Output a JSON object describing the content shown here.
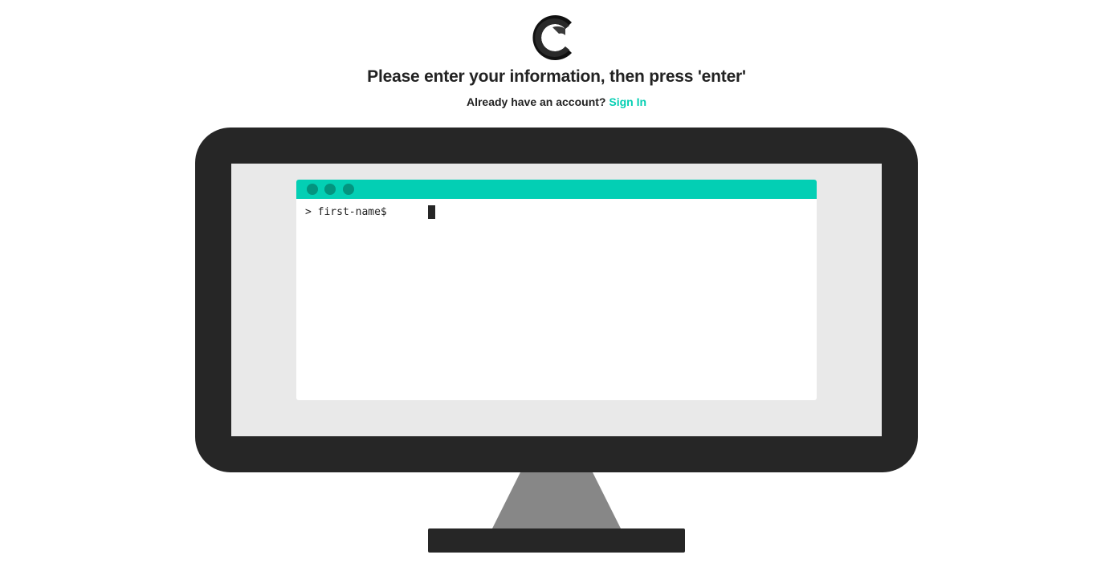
{
  "header": {
    "logo_icon": "c-logo-icon",
    "headline": "Please enter your information, then press 'enter'",
    "account_prompt": "Already have an account?",
    "sign_in_link": "Sign In"
  },
  "terminal": {
    "window_dots": [
      "window-dot-icon",
      "window-dot-icon",
      "window-dot-icon"
    ],
    "prompt_symbol": ">",
    "prompt_label": "first-name$",
    "input_value": ""
  },
  "colors": {
    "accent": "#03cfb4",
    "accent_dark": "#03947f",
    "bezel": "#262626",
    "screen": "#e9e9e9",
    "stand": "#878787"
  }
}
